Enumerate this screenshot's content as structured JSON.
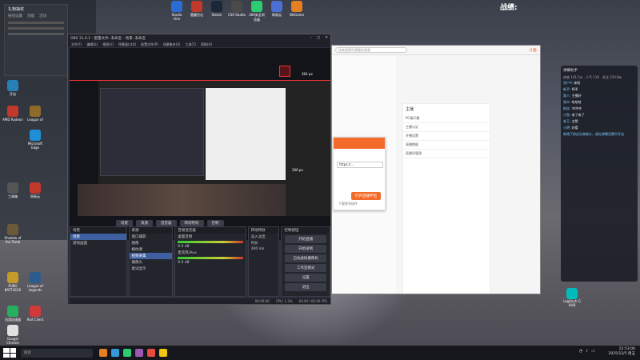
{
  "banner_text": "战绩:",
  "top_icons": [
    {
      "label": "Studio One",
      "color": "#2a6cd4"
    },
    {
      "label": "雷霆合击",
      "color": "#c0392b"
    },
    {
      "label": "Steam",
      "color": "#1b2838"
    },
    {
      "label": "CSS Studio",
      "color": "#4a4a4a"
    },
    {
      "label": "360安全浏览器",
      "color": "#2ecc71"
    },
    {
      "label": "网易云",
      "color": "#4a6fd4"
    },
    {
      "label": "WeGame",
      "color": "#e67e22"
    }
  ],
  "left_mini_window": {
    "title": "礼物抽奖",
    "tabs": [
      "按钮设置",
      "功能",
      "活动"
    ]
  },
  "desktop_icons": [
    {
      "label": "开启",
      "color": "#2980b9"
    },
    {
      "label": "AMD Radeon",
      "color": "#c0392b"
    },
    {
      "label": "League of",
      "color": "#8e6b2b"
    },
    {
      "label": "Microsoft Edge",
      "color": "#1e8fd4"
    },
    {
      "label": "网易云",
      "color": "#c0392b"
    },
    {
      "label": "工具箱",
      "color": "#555"
    },
    {
      "label": "Shadow of the Tomb",
      "color": "#6b5a3a"
    },
    {
      "label": "PUBG BATTLEGR",
      "color": "#c49a2b"
    },
    {
      "label": "League of Legends",
      "color": "#2b5c8e"
    },
    {
      "label": "迅游加速器",
      "color": "#27ae60"
    },
    {
      "label": "Riot Client",
      "color": "#d03a3a"
    },
    {
      "label": "Google Chrome",
      "color": "#e0e0e0"
    }
  ],
  "obs": {
    "title": "OBS 31.0.1 - 配置文件: 未命名 - 场景: 未命名",
    "menu": [
      "文件(F)",
      "编辑(E)",
      "视图(V)",
      "停靠窗口(D)",
      "配置文件(P)",
      "场景集合(S)",
      "工具(T)",
      "帮助(H)"
    ],
    "px_label_1": "364 px",
    "px_label_2": "300 px",
    "dock_tabs": [
      "场景",
      "来源",
      "混音器",
      "转场特效",
      "控制"
    ],
    "scenes_header": "场景",
    "scenes": [
      "场景",
      "游戏画面"
    ],
    "sources_header": "来源",
    "sources": [
      "窗口捕获",
      "图像",
      "媒体源",
      "视频采集",
      "摄像头",
      "歌词显示"
    ],
    "mixer_header": "音频混音器",
    "mixer": [
      {
        "name": "桌面音频",
        "value": "0.0 dB"
      },
      {
        "name": "麦克风/Aux",
        "value": "0.0 dB"
      }
    ],
    "transitions_header": "转场特效",
    "transition_value": "淡入淡出",
    "duration_label": "时长",
    "duration_value": "300 ms",
    "controls_header": "控制按钮",
    "controls": [
      "开始直播",
      "开始录制",
      "启动虚拟摄像机",
      "工作室模式",
      "设置",
      "退出"
    ],
    "status_cpu": "CPU: 1.3%",
    "status_fps": "60.00 / 60.00 FPS",
    "status_time": "00:00:00"
  },
  "browser": {
    "search_placeholder": "快来搜索你想看的视频",
    "brand": "斗鱼",
    "popup_input": "https://...",
    "popup_button": "打开直播伴侣",
    "popup_note": "下载更多插件",
    "main_header": "主播",
    "main_items": [
      "PC端开播",
      "主播认证",
      "开播设置",
      "直播数据",
      "直播间管理"
    ]
  },
  "chat": {
    "title": "弹幕助手",
    "stats": [
      "热度 141.5w",
      "人气 110",
      "关注 210.8w"
    ],
    "messages": [
      {
        "name": "用户A",
        "text": "来啦"
      },
      {
        "name": "新手",
        "text": "666"
      },
      {
        "name": "路人",
        "text": "主播好"
      },
      {
        "name": "观众",
        "text": "哈哈哈"
      },
      {
        "name": "粉丝",
        "text": "冲冲冲"
      },
      {
        "name": "小鱼",
        "text": "来了来了"
      },
      {
        "name": "老王",
        "text": "点赞"
      },
      {
        "name": "小明",
        "text": "好看"
      }
    ],
    "notice": "新增了粉丝礼物统计，请在弹幕设置中开启"
  },
  "logitech_label": "Logitech G HUB",
  "taskbar": {
    "search_placeholder": "搜索",
    "app_colors": [
      "#e67e22",
      "#3498db",
      "#2ecc71",
      "#9b59b6",
      "#e74c3c",
      "#f1c40f"
    ],
    "time": "22:53:00",
    "date": "2025/12/5 周五"
  }
}
